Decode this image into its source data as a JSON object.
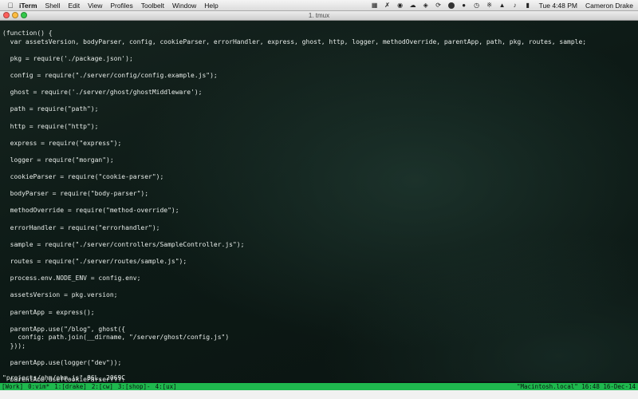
{
  "menubar": {
    "app_name": "iTerm",
    "menus": [
      "Shell",
      "Edit",
      "View",
      "Profiles",
      "Toolbelt",
      "Window",
      "Help"
    ],
    "status_icons": [
      "app-icon",
      "tools-icon",
      "cat-icon",
      "cloud-icon",
      "headphones-icon",
      "sync-icon",
      "location-icon",
      "message-icon",
      "clock-icon",
      "bluetooth-icon",
      "wifi-icon",
      "volume-icon",
      "battery-icon"
    ],
    "clock": "Tue 4:48 PM",
    "user": "Cameron Drake"
  },
  "window": {
    "title": "1. tmux"
  },
  "terminal": {
    "lines": [
      "(function() {",
      "  var assetsVersion, bodyParser, config, cookieParser, errorHandler, express, ghost, http, logger, methodOverride, parentApp, path, pkg, routes, sample;",
      "",
      "  pkg = require('./package.json');",
      "",
      "  config = require(\"./server/config/config.example.js\");",
      "",
      "  ghost = require('./server/ghost/ghostMiddleware');",
      "",
      "  path = require(\"path\");",
      "",
      "  http = require(\"http\");",
      "",
      "  express = require(\"express\");",
      "",
      "  logger = require(\"morgan\");",
      "",
      "  cookieParser = require(\"cookie-parser\");",
      "",
      "  bodyParser = require(\"body-parser\");",
      "",
      "  methodOverride = require(\"method-override\");",
      "",
      "  errorHandler = require(\"errorhandler\");",
      "",
      "  sample = require(\"./server/controllers/SampleController.js\");",
      "",
      "  routes = require(\"./server/routes/sample.js\");",
      "",
      "  process.env.NODE_ENV = config.env;",
      "",
      "  assetsVersion = pkg.version;",
      "",
      "  parentApp = express();",
      "",
      "  parentApp.use(\"/blog\", ghost({",
      "    config: path.join(__dirname, \"/server/ghost/config.js\")",
      "  }));",
      "",
      "  parentApp.use(logger(\"dev\"));",
      "",
      "  parentApp.use(cookieParser());"
    ],
    "file_status": "\"projects/ohm/ohm.js\" 86L, 2069C"
  },
  "tmux": {
    "session": "[Work]",
    "windows": [
      "0:vim*",
      "1:[drake]",
      "2:[cw]",
      "3:[shop]-",
      "4:[ux]"
    ],
    "host": "\"Macintosh.local\"",
    "time": "16:48",
    "date": "16-Dec-14",
    "bar_color": "#1fb84e"
  }
}
